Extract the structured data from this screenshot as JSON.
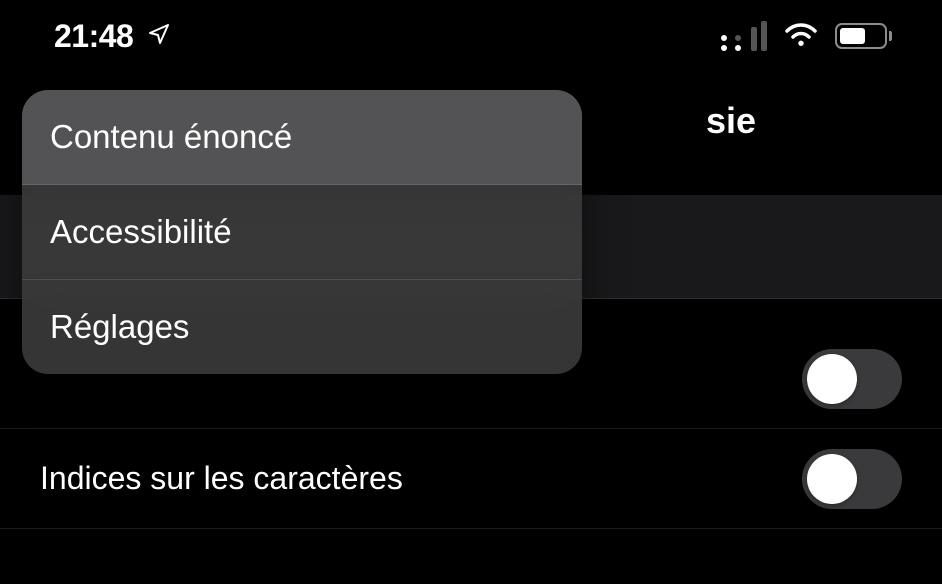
{
  "statusBar": {
    "time": "21:48"
  },
  "header": {
    "title": "sie"
  },
  "popup": {
    "items": [
      {
        "label": "Contenu énoncé",
        "active": true
      },
      {
        "label": "Accessibilité",
        "active": false
      },
      {
        "label": "Réglages",
        "active": false
      }
    ]
  },
  "settings": {
    "rows": [
      {
        "label": "",
        "toggle": true
      },
      {
        "label": "Indices sur les caractères",
        "toggle": true
      }
    ]
  }
}
